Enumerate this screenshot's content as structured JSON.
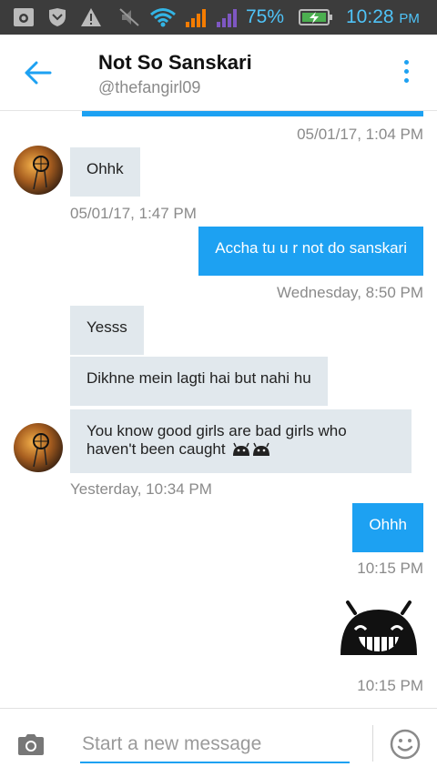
{
  "status_bar": {
    "battery_percent": "75%",
    "time": "10:28",
    "ampm": "PM"
  },
  "header": {
    "title": "Not So Sanskari",
    "handle": "@thefangirl09"
  },
  "messages": {
    "stamp_top": "05/01/17, 1:04 PM",
    "m1": "Ohhk",
    "stamp_1": "05/01/17, 1:47 PM",
    "m2": "Accha tu u r not do sanskari",
    "stamp_2": "Wednesday, 8:50 PM",
    "m3": "Yesss",
    "m4": "Dikhne mein lagti hai but nahi hu",
    "m5_line1": "You know good girls are bad girls who",
    "m5_line2": "haven't been caught",
    "stamp_3": "Yesterday, 10:34 PM",
    "m6": "Ohhh",
    "stamp_4": "10:15 PM",
    "stamp_5": "10:15 PM"
  },
  "composer": {
    "placeholder": "Start a new message"
  },
  "colors": {
    "accent": "#1da1f2",
    "incoming_bubble": "#e1e8ed",
    "statusbar": "#3c3c3c"
  }
}
